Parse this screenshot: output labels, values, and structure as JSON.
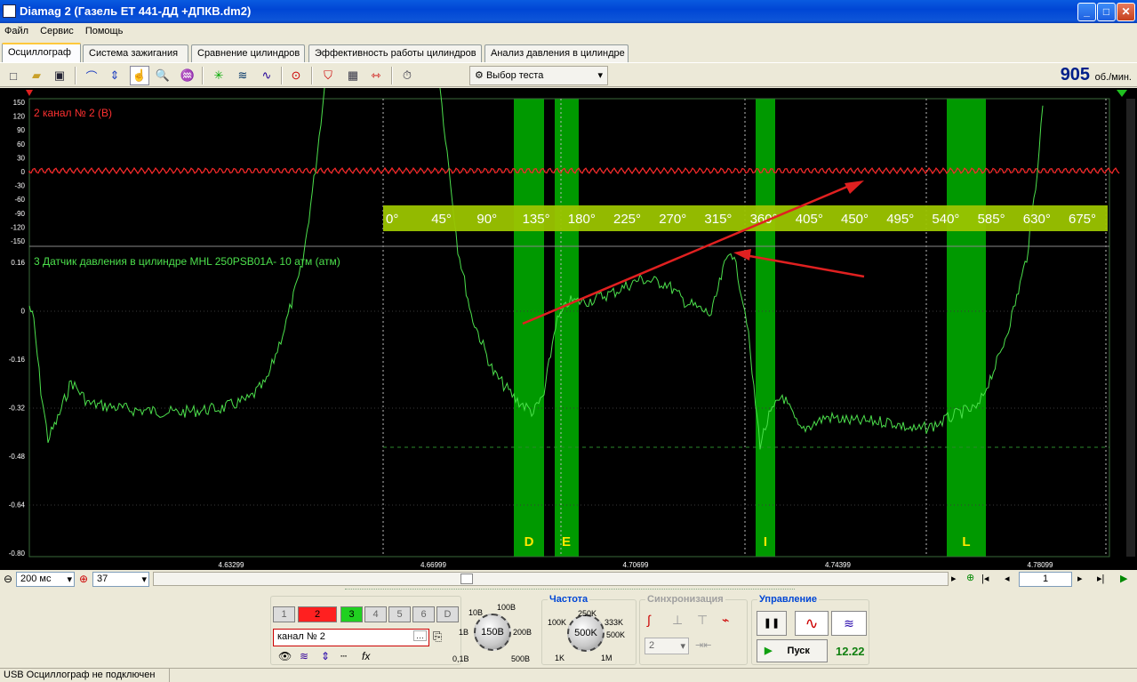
{
  "window": {
    "title": "Diamag 2 (Газель ЕТ 441-ДД +ДПКВ.dm2)"
  },
  "menu": [
    "Файл",
    "Сервис",
    "Помощь"
  ],
  "tabs": [
    "Осциллограф",
    "Система зажигания",
    "Сравнение цилиндров",
    "Эффективность работы цилиндров",
    "Анализ давления в цилиндре"
  ],
  "toolbar": {
    "test_select": "Выбор теста",
    "rpm_value": "905",
    "rpm_unit": "об./мин."
  },
  "scope": {
    "ch2_label": "2  канал № 2 (В)",
    "ch2_ticks": [
      "150",
      "120",
      "90",
      "60",
      "30",
      "0",
      "-30",
      "-60",
      "-90",
      "-120",
      "-150"
    ],
    "ch3_label": "3 Датчик давления в цилиндре MHL 250PSB01A- 10 атм (атм)",
    "ch3_ticks": [
      "0.16",
      "0",
      "-0.16",
      "-0.32",
      "-0.48",
      "-0.64",
      "-0.80"
    ],
    "angle_labels": [
      "0°",
      "45°",
      "90°",
      "135°",
      "180°",
      "225°",
      "270°",
      "315°",
      "360°",
      "405°",
      "450°",
      "495°",
      "540°",
      "585°",
      "630°",
      "675°"
    ],
    "time_labels": [
      "4.63299",
      "4.66999",
      "4.70699",
      "4.74399",
      "4.78099"
    ],
    "markers": [
      "D",
      "E",
      "I",
      "L"
    ]
  },
  "bottom": {
    "timebase": "200 мс",
    "zoom": "37",
    "page": "1"
  },
  "channels": {
    "buttons": [
      "1",
      "2",
      "3",
      "4",
      "5",
      "6",
      "D"
    ],
    "name": "канал № 2"
  },
  "voltage": {
    "value": "150В",
    "scale": [
      "10В",
      "100В",
      "1В",
      "200В",
      "0,1В",
      "500В"
    ]
  },
  "frequency": {
    "title": "Частота",
    "value": "500K",
    "scale": [
      "250K",
      "100K",
      "333K",
      "500K",
      "1K",
      "1M"
    ]
  },
  "sync": {
    "title": "Синхронизация",
    "value": "2"
  },
  "control": {
    "title": "Управление",
    "start": "Пуск",
    "value": "12.22"
  },
  "status": "USB Осциллограф не подключен",
  "colors": {
    "ch2": "#FF2A2A",
    "ch3": "#4CE04C",
    "marker": "#009900",
    "ruler": "#9BC400"
  }
}
